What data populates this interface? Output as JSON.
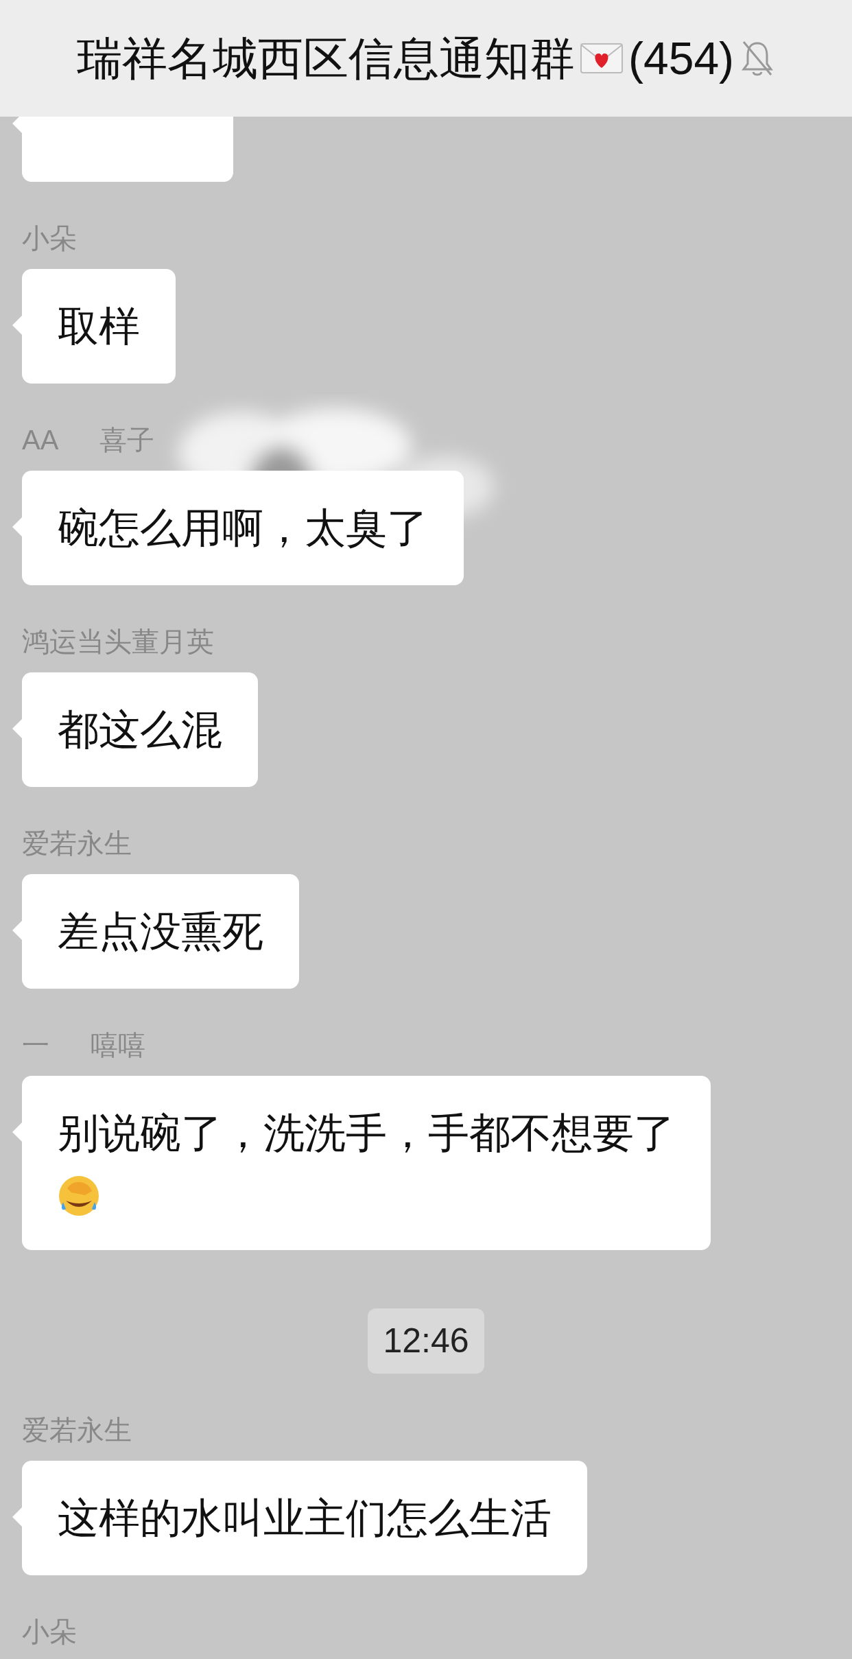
{
  "header": {
    "title": "瑞祥名城西区信息通知群",
    "member_count": "(454)",
    "muted": true
  },
  "items": [
    {
      "kind": "message"
    },
    {
      "kind": "message",
      "sender": [
        "小朵"
      ],
      "text": "取样"
    },
    {
      "kind": "message",
      "sender": [
        "AA",
        "喜子"
      ],
      "text": "碗怎么用啊，太臭了",
      "redacted": true
    },
    {
      "kind": "message",
      "sender": [
        "鸿运当头董月英"
      ],
      "text": "都这么混"
    },
    {
      "kind": "message",
      "sender": [
        "爱若永生"
      ],
      "text": "差点没熏死"
    },
    {
      "kind": "message",
      "sender": [
        "一",
        "嘻嘻"
      ],
      "text": "别说碗了，洗洗手，手都不想要了",
      "trailing_emoji": true
    },
    {
      "kind": "time",
      "text": "12:46"
    },
    {
      "kind": "message",
      "sender": [
        "爱若永生"
      ],
      "text": "这样的水叫业主们怎么生活"
    },
    {
      "kind": "message",
      "sender": [
        "小朵"
      ]
    }
  ]
}
